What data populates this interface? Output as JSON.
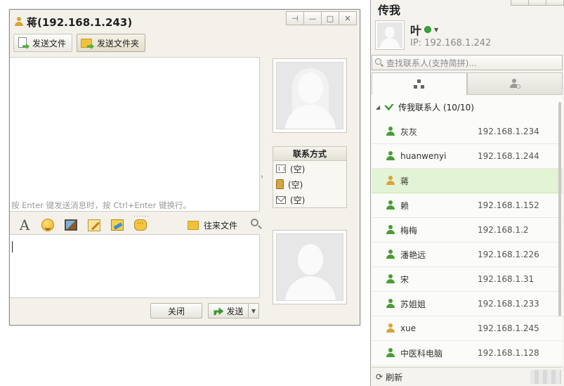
{
  "chat": {
    "title": "蒋(192.168.1.243)",
    "toolbar": {
      "send_file": "发送文件",
      "send_folder": "发送文件夹"
    },
    "hint": "按 Enter 键发送消息时，按 Ctrl+Enter 键换行。",
    "sizer": "......",
    "files_label": "往来文件",
    "font_glyph": "A",
    "close_label": "关闭",
    "send_label": "发送",
    "contact": {
      "title": "联系方式",
      "items": [
        "(空)",
        "(空)",
        "(空)"
      ]
    }
  },
  "panel": {
    "title": "传我",
    "me": {
      "name": "叶",
      "ip": "IP: 192.168.1.242"
    },
    "search_placeholder": "查找联系人(支持简拼)...",
    "group": {
      "name": "传我联系人 (10/10)"
    },
    "contacts": [
      {
        "name": "灰灰",
        "ip": "192.168.1.234",
        "icon": "user-green"
      },
      {
        "name": "huanwenyi",
        "ip": "192.168.1.244",
        "icon": "user-green"
      },
      {
        "name": "蒋",
        "ip": "",
        "icon": "user-orange",
        "selected": true
      },
      {
        "name": "赖",
        "ip": "192.168.1.152",
        "icon": "user-green"
      },
      {
        "name": "梅梅",
        "ip": "192.168.1.2",
        "icon": "user-green"
      },
      {
        "name": "潘艳远",
        "ip": "192.168.1.226",
        "icon": "user-green"
      },
      {
        "name": "宋",
        "ip": "192.168.1.31",
        "icon": "user-green"
      },
      {
        "name": "苏姐姐",
        "ip": "192.168.1.233",
        "icon": "user-green"
      },
      {
        "name": "xue",
        "ip": "192.168.1.245",
        "icon": "user-orange"
      },
      {
        "name": "中医科电脑",
        "ip": "192.168.1.128",
        "icon": "user-green"
      }
    ],
    "refresh_label": "刷新"
  },
  "colors": {
    "selected_row": "#e3f3d5",
    "status_online": "#35a43a",
    "user_green": "#4a9c35",
    "user_orange": "#d9a43a"
  }
}
